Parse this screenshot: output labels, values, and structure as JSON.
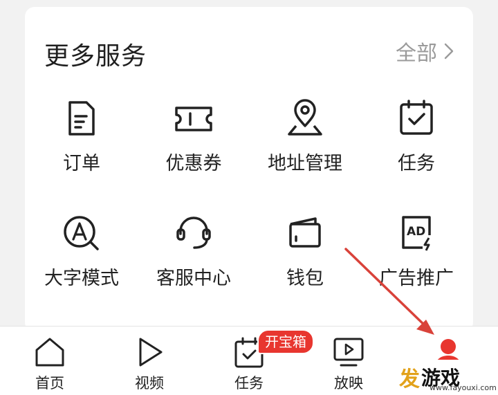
{
  "section": {
    "title": "更多服务",
    "all_label": "全部"
  },
  "services": [
    {
      "label": "订单",
      "icon": "document-icon"
    },
    {
      "label": "优惠券",
      "icon": "ticket-icon"
    },
    {
      "label": "地址管理",
      "icon": "location-pin-icon"
    },
    {
      "label": "任务",
      "icon": "task-calendar-icon"
    },
    {
      "label": "大字模式",
      "icon": "large-text-icon"
    },
    {
      "label": "客服中心",
      "icon": "headset-icon"
    },
    {
      "label": "钱包",
      "icon": "wallet-icon"
    },
    {
      "label": "广告推广",
      "icon": "ad-icon"
    }
  ],
  "tabbar": [
    {
      "label": "首页",
      "icon": "home-icon"
    },
    {
      "label": "视频",
      "icon": "play-icon"
    },
    {
      "label": "任务",
      "icon": "task-icon",
      "badge": "开宝箱"
    },
    {
      "label": "放映",
      "icon": "screen-play-icon"
    },
    {
      "label": "",
      "icon": "profile-icon"
    }
  ],
  "watermark": {
    "logo_a": "发",
    "logo_b": "游戏",
    "url": "www.fayouxi.com"
  },
  "colors": {
    "accent": "#e8362f",
    "watermark": "#e2a21b",
    "arrow": "#d9423a"
  }
}
